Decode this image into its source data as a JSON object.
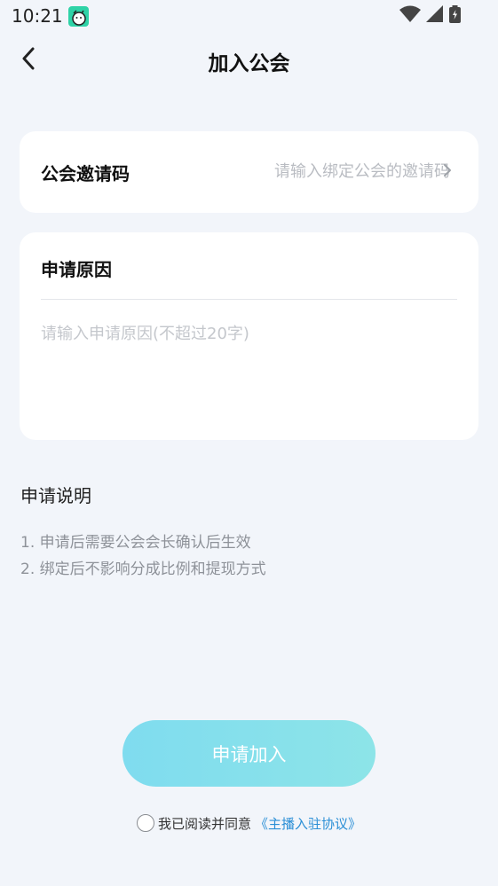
{
  "status_bar": {
    "time": "10:21",
    "app_icon": "app-notification-icon",
    "wifi_icon": "wifi-icon",
    "signal_icon": "signal-icon",
    "battery_icon": "battery-icon"
  },
  "nav": {
    "back_icon": "chevron-left-icon",
    "title": "加入公会"
  },
  "invite": {
    "label": "公会邀请码",
    "placeholder": "请输入绑定公会的邀请码",
    "value": "",
    "chevron_icon": "chevron-right-icon"
  },
  "reason": {
    "label": "申请原因",
    "placeholder": "请输入申请原因(不超过20字)",
    "value": ""
  },
  "notes": {
    "title": "申请说明",
    "items": [
      "1. 申请后需要公会会长确认后生效",
      "2. 绑定后不影响分成比例和提现方式"
    ]
  },
  "submit": {
    "label": "申请加入"
  },
  "agreement": {
    "checked": false,
    "text": "我已阅读并同意",
    "link": "《主播入驻协议》"
  },
  "colors": {
    "background": "#f2f5fa",
    "button_gradient_start": "#7fdcef",
    "button_gradient_end": "#8de4e8",
    "link": "#2b8fd6"
  }
}
